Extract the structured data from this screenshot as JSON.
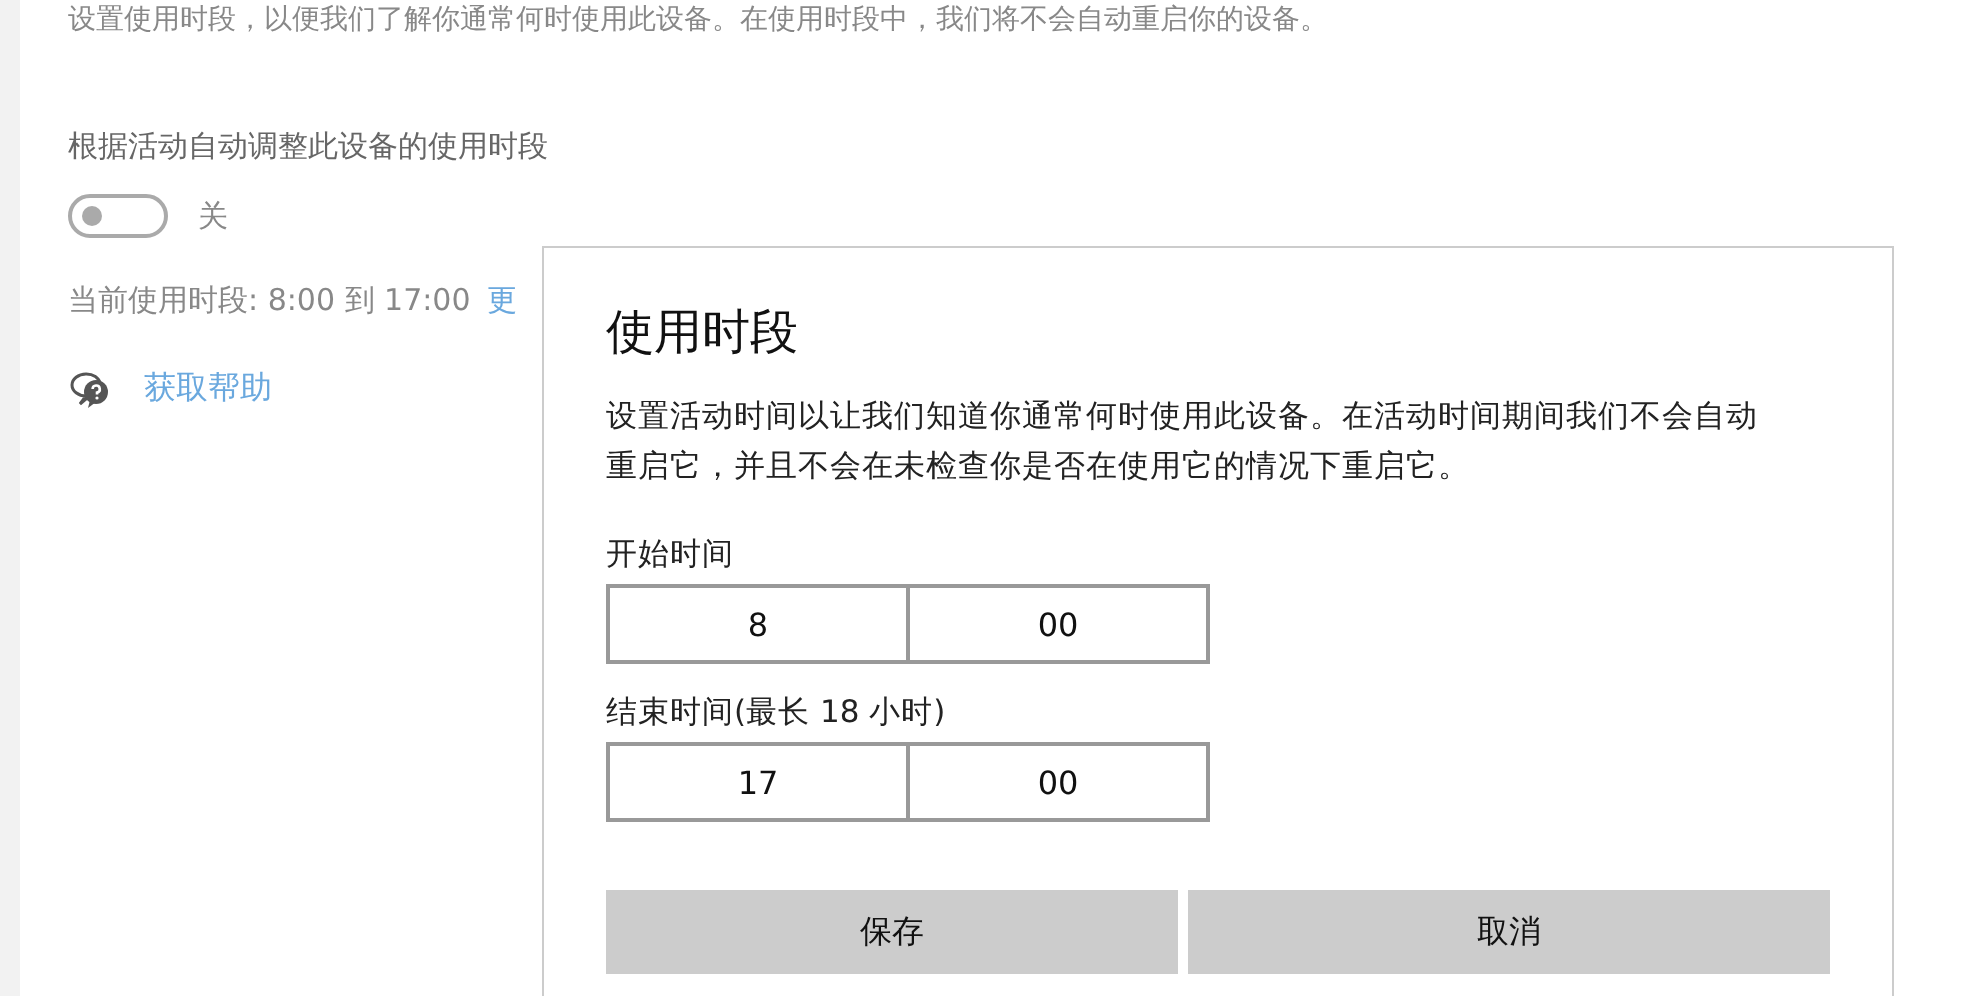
{
  "page": {
    "intro": "设置使用时段，以便我们了解你通常何时使用此设备。在使用时段中，我们将不会自动重启你的设备。",
    "auto_adjust": {
      "label": "根据活动自动调整此设备的使用时段",
      "on": false,
      "state_text": "关"
    },
    "current_hours": "当前使用时段: 8:00 到 17:00",
    "change_link": "更",
    "help_link": "获取帮助"
  },
  "dialog": {
    "title": "使用时段",
    "description": "设置活动时间以让我们知道你通常何时使用此设备。在活动时间期间我们不会自动重启它，并且不会在未检查你是否在使用它的情况下重启它。",
    "fields": [
      {
        "label": "开始时间",
        "hour": "8",
        "minute": "00"
      },
      {
        "label": "结束时间(最长 18 小时)",
        "hour": "17",
        "minute": "00"
      }
    ],
    "buttons": [
      "保存",
      "取消"
    ]
  }
}
